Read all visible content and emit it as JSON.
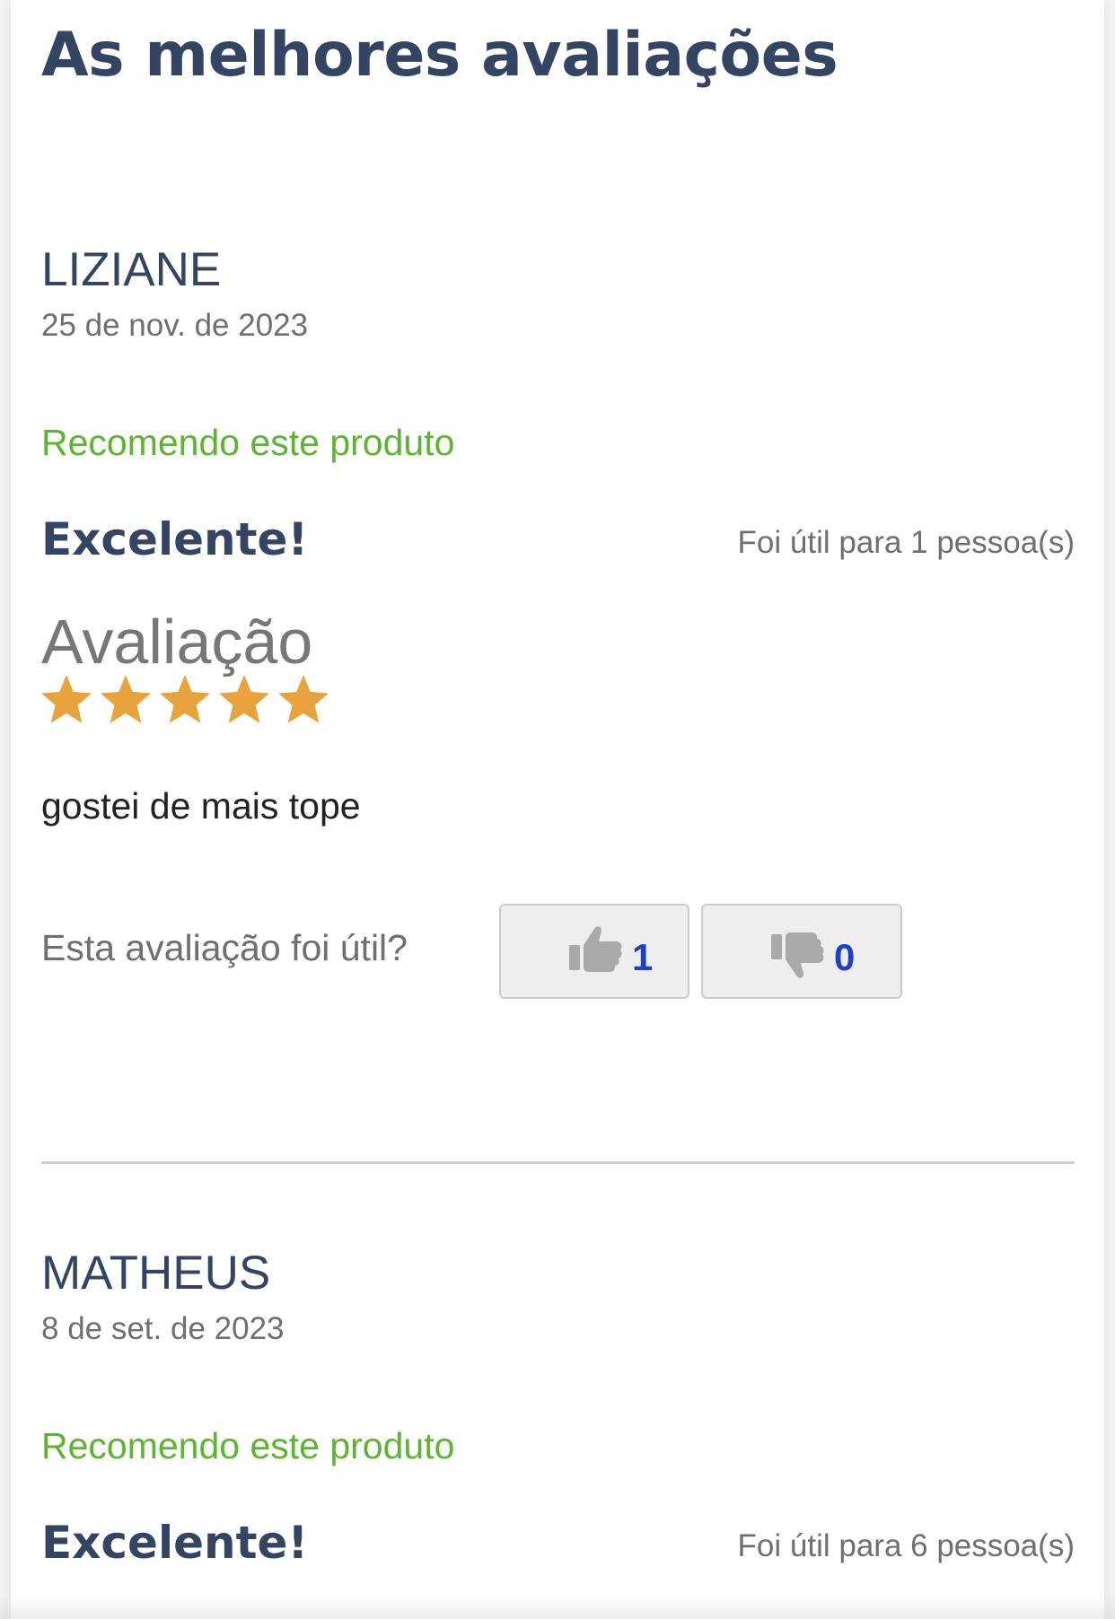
{
  "section_title": "As melhores avaliações",
  "colors": {
    "heading": "#344563",
    "recommend": "#5cb531",
    "star": "#e8a33d",
    "vote_count": "#1f3fc9",
    "muted_text": "#6f6f6f"
  },
  "reviews": [
    {
      "author": "LIZIANE",
      "date": "25 de nov. de 2023",
      "recommend": "Recomendo este produto",
      "title": "Excelente!",
      "useful_count_text": "Foi útil para 1 pessoa(s)",
      "rating_label": "Avaliação",
      "rating": 5,
      "text": "gostei de mais tope",
      "helpful_question": "Esta avaliação foi útil?",
      "votes": {
        "up": "1",
        "down": "0",
        "up_icon": "thumbs-up-icon",
        "down_icon": "thumbs-down-icon"
      }
    },
    {
      "author": "MATHEUS",
      "date": "8 de set. de 2023",
      "recommend": "Recomendo este produto",
      "title": "Excelente!",
      "useful_count_text": "Foi útil para 6 pessoa(s)"
    }
  ]
}
